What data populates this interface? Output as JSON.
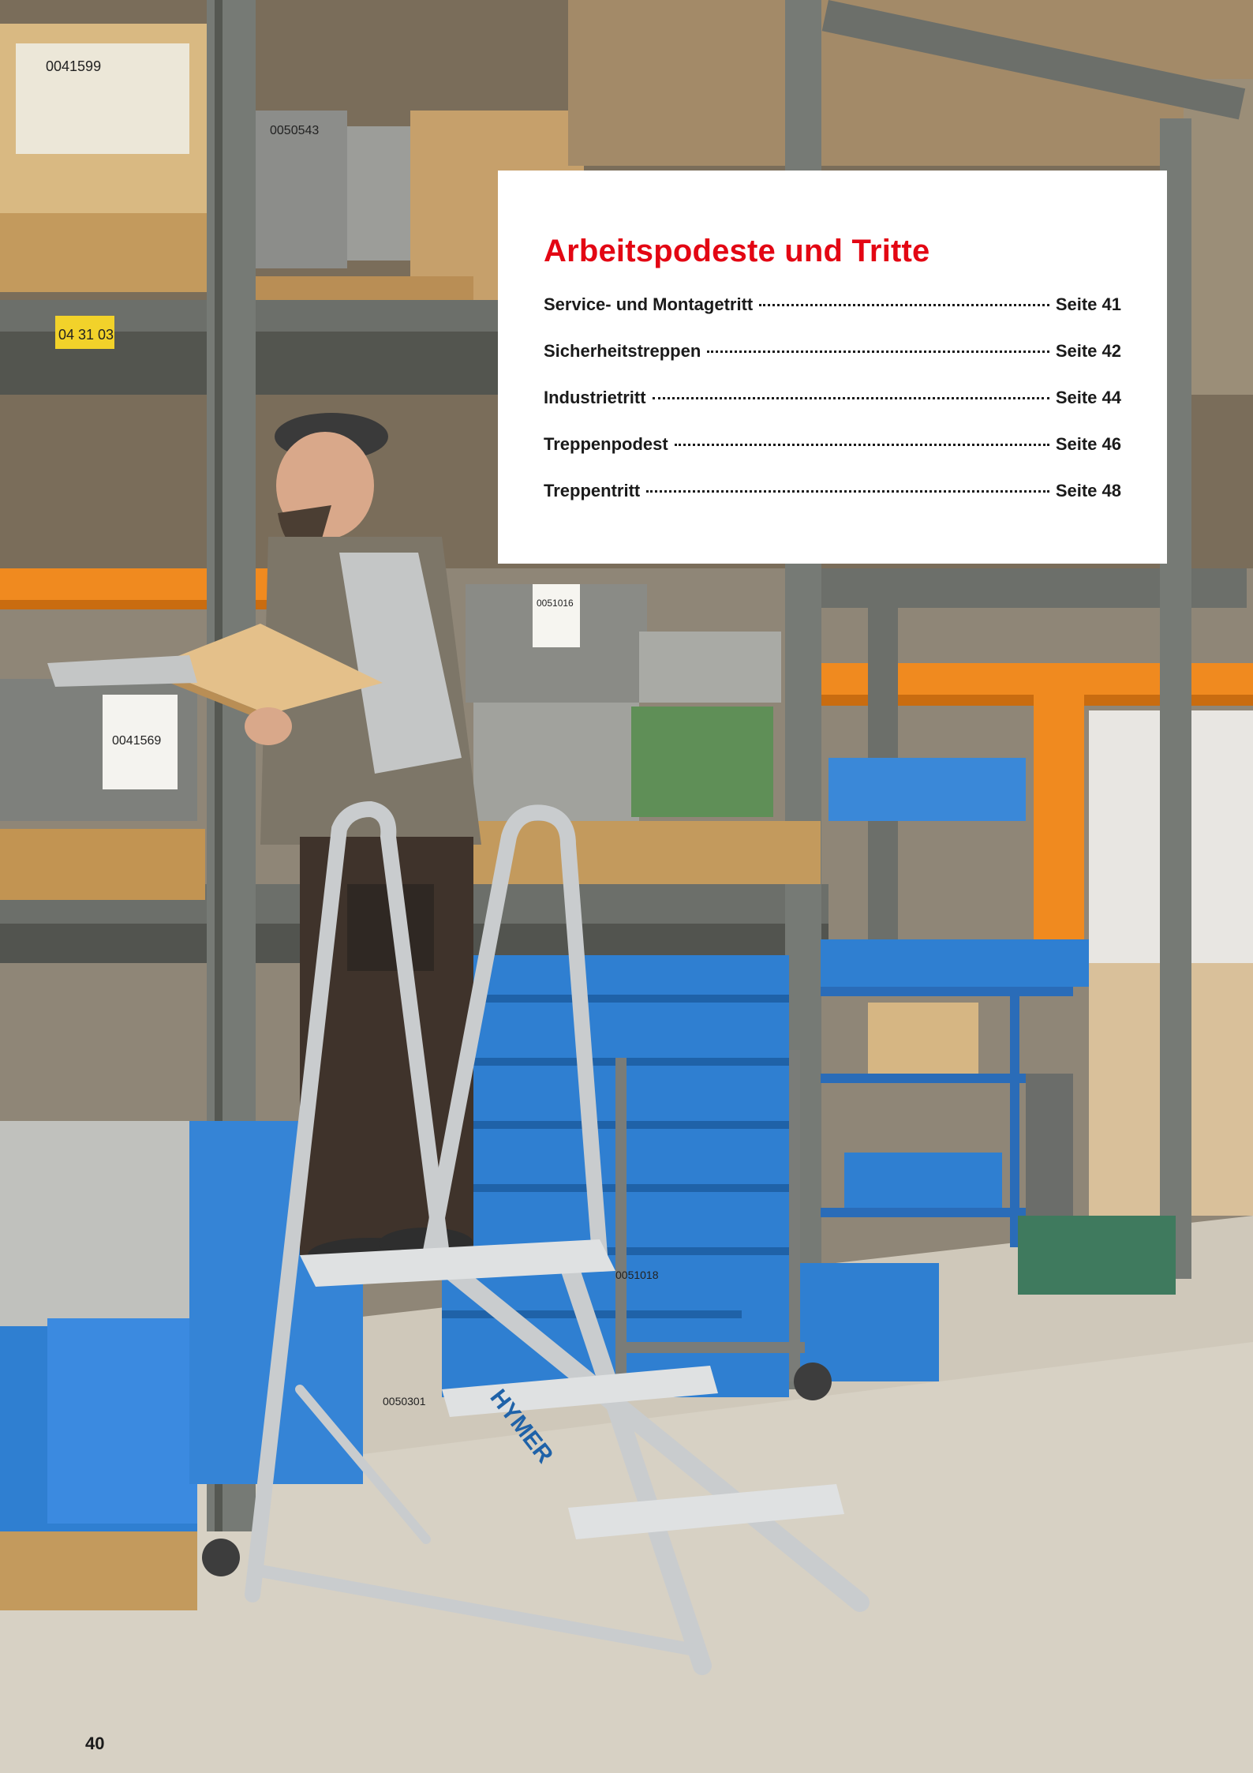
{
  "toc": {
    "title": "Arbeitspodeste und Tritte",
    "entries": [
      {
        "label": "Service- und Montagetritt",
        "page": "Seite 41"
      },
      {
        "label": "Sicherheitstreppen",
        "page": "Seite 42"
      },
      {
        "label": "Industrietritt",
        "page": "Seite 44"
      },
      {
        "label": "Treppenpodest",
        "page": "Seite 46"
      },
      {
        "label": "Treppentritt",
        "page": "Seite 48"
      }
    ]
  },
  "photo": {
    "bin_labels": [
      "0041599",
      "0050543",
      "0041569",
      "0051016",
      "0050301",
      "0051018",
      "04 31 03"
    ],
    "ladder_brand": "HYMER"
  },
  "page_number": "40",
  "colors": {
    "accent": "#e30613",
    "rack_grey": "#6c6f6a",
    "crate_blue": "#2f7fd1",
    "beam_orange": "#f08a1f",
    "aluminium": "#c9ccce"
  }
}
